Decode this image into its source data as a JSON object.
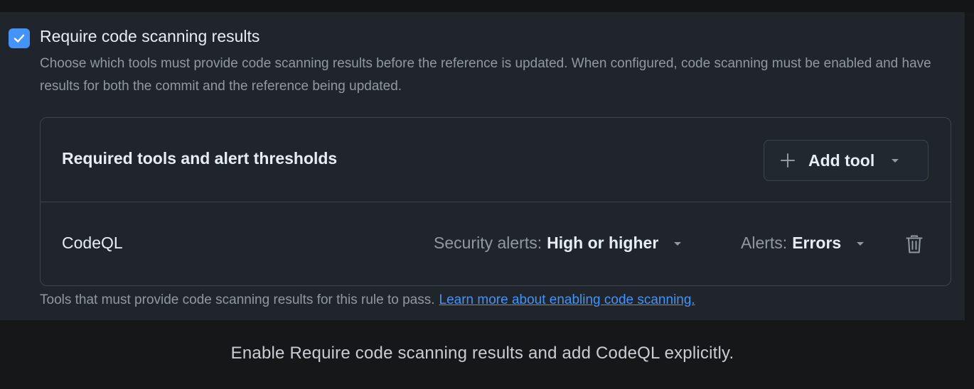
{
  "setting": {
    "checked": true,
    "title": "Require code scanning results",
    "description": "Choose which tools must provide code scanning results before the reference is updated. When configured, code scanning must be enabled and have results for both the commit and the reference being updated."
  },
  "tools_box": {
    "header_title": "Required tools and alert thresholds",
    "add_tool_label": "Add tool",
    "rows": [
      {
        "tool": "CodeQL",
        "security_alerts_key": "Security alerts:",
        "security_alerts_value": "High or higher",
        "alerts_key": "Alerts:",
        "alerts_value": "Errors"
      }
    ]
  },
  "footnote": {
    "text": "Tools that must provide code scanning results for this rule to pass.",
    "link": "Learn more about enabling code scanning."
  },
  "caption": "Enable Require code scanning results and add CodeQL explicitly.",
  "icons": [
    "check-icon",
    "plus-icon",
    "chevron-down-icon",
    "trash-icon"
  ],
  "colors": {
    "accent": "#4493f8",
    "panel_bg": "#20252c",
    "border": "#3d444d"
  }
}
